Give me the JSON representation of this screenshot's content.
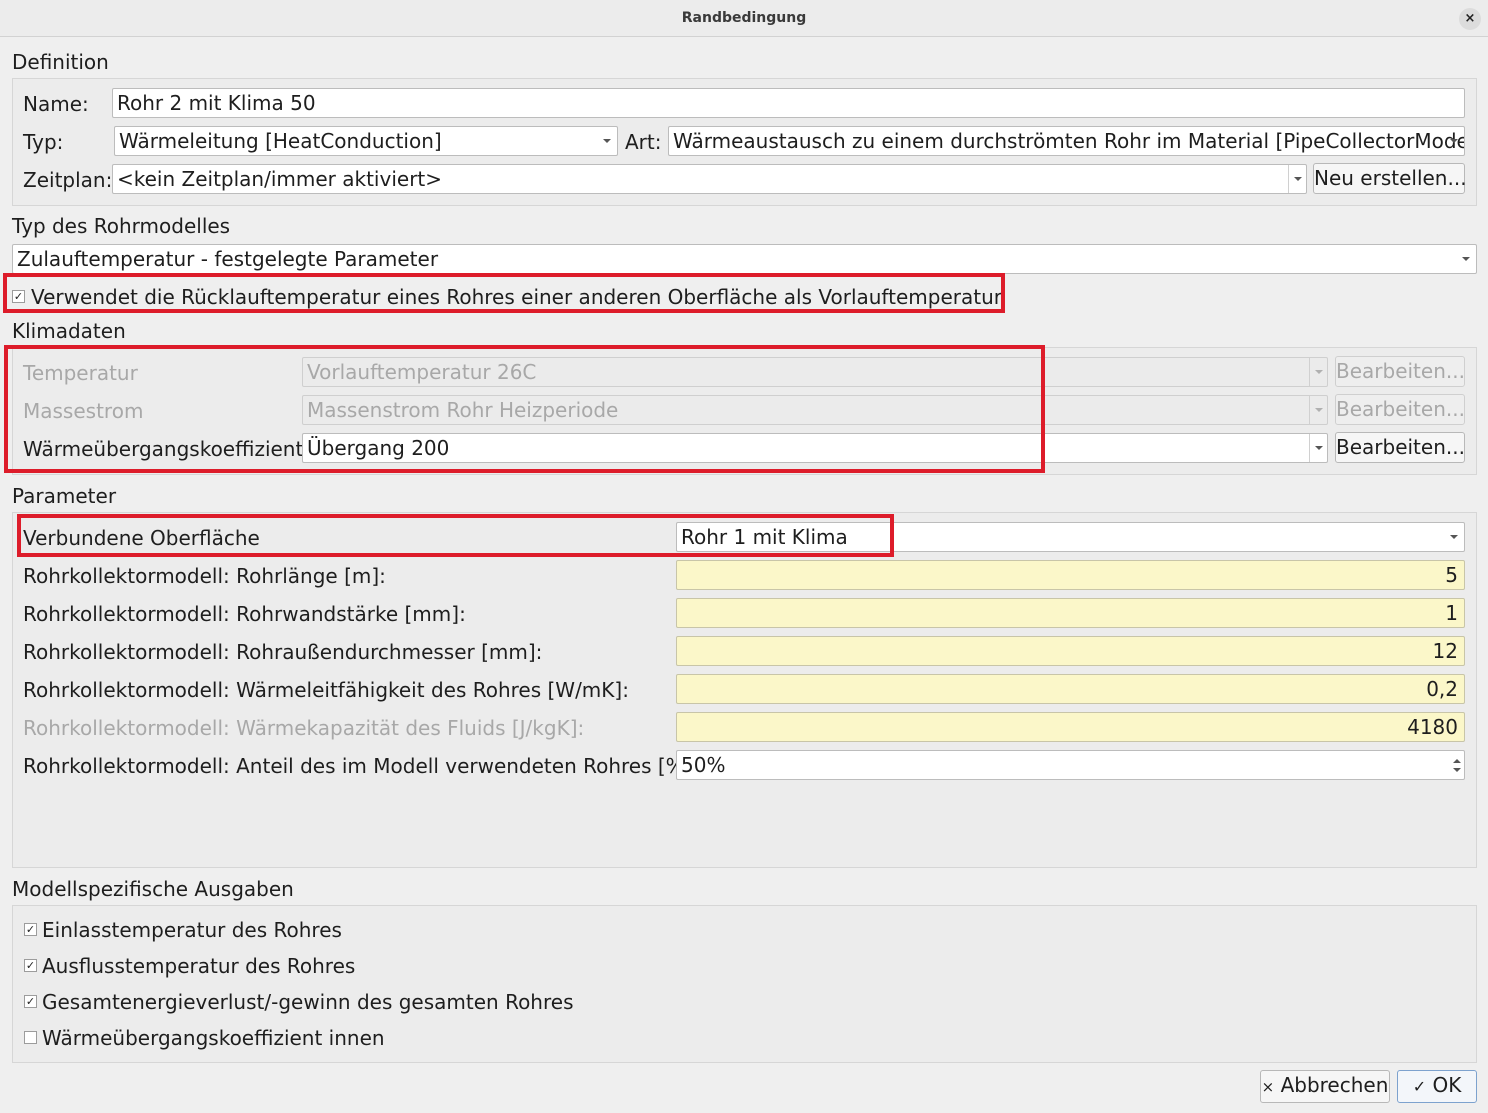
{
  "window": {
    "title": "Randbedingung",
    "close_glyph": "×"
  },
  "definition": {
    "section": "Definition",
    "name_label": "Name:",
    "name_value": "Rohr 2 mit Klima 50",
    "typ_label": "Typ:",
    "typ_value": "Wärmeleitung [HeatConduction]",
    "art_label": "Art:",
    "art_value": "Wärmeaustausch zu einem durchströmten Rohr im Material [PipeCollectorModel]",
    "zeitplan_label": "Zeitplan:",
    "zeitplan_value": "<kein Zeitplan/immer aktiviert>",
    "neu_button": "Neu erstellen..."
  },
  "rohrmodell": {
    "section": "Typ des Rohrmodelles",
    "value": "Zulauftemperatur - festgelegte Parameter",
    "checkbox_label": "Verwendet die Rücklauftemperatur eines Rohres einer anderen Oberfläche als Vorlauftemperatur",
    "checkbox_checked": true
  },
  "klimadaten": {
    "section": "Klimadaten",
    "rows": [
      {
        "label": "Temperatur",
        "value": "Vorlauftemperatur 26C",
        "button": "Bearbeiten...",
        "enabled": false
      },
      {
        "label": "Massestrom",
        "value": "Massenstrom Rohr Heizperiode",
        "button": "Bearbeiten...",
        "enabled": false
      },
      {
        "label": "Wärmeübergangskoeffizient",
        "value": "Übergang 200",
        "button": "Bearbeiten...",
        "enabled": true
      }
    ]
  },
  "parameter": {
    "section": "Parameter",
    "verbunden_label": "Verbundene Oberfläche",
    "verbunden_value": "Rohr 1 mit Klima",
    "rows": [
      {
        "label": "Rohrkollektormodell: Rohrlänge [m]:",
        "value": "5",
        "enabled": true
      },
      {
        "label": "Rohrkollektormodell: Rohrwandstärke [mm]:",
        "value": "1",
        "enabled": true
      },
      {
        "label": "Rohrkollektormodell: Rohraußendurchmesser [mm]:",
        "value": "12",
        "enabled": true
      },
      {
        "label": "Rohrkollektormodell: Wärmeleitfähigkeit des Rohres [W/mK]:",
        "value": "0,2",
        "enabled": true
      },
      {
        "label": "Rohrkollektormodell: Wärmekapazität des Fluids [J/kgK]:",
        "value": "4180",
        "enabled": false
      }
    ],
    "anteil_label": "Rohrkollektormodell: Anteil des im Modell verwendeten Rohres [%]:",
    "anteil_value": "50%"
  },
  "ausgaben": {
    "section": "Modellspezifische Ausgaben",
    "items": [
      {
        "label": "Einlasstemperatur des Rohres",
        "checked": true
      },
      {
        "label": "Ausflusstemperatur des Rohres",
        "checked": true
      },
      {
        "label": "Gesamtenergieverlust/-gewinn des gesamten Rohres",
        "checked": true
      },
      {
        "label": "Wärmeübergangskoeffizient innen",
        "checked": false
      }
    ]
  },
  "footer": {
    "cancel_label": "Abbrechen",
    "cancel_glyph": "×",
    "ok_label": "OK",
    "ok_glyph": "✓"
  },
  "colors": {
    "highlight": "#dd1c2a",
    "numeric_field": "#fbf7c9"
  },
  "check_glyph": "✓"
}
